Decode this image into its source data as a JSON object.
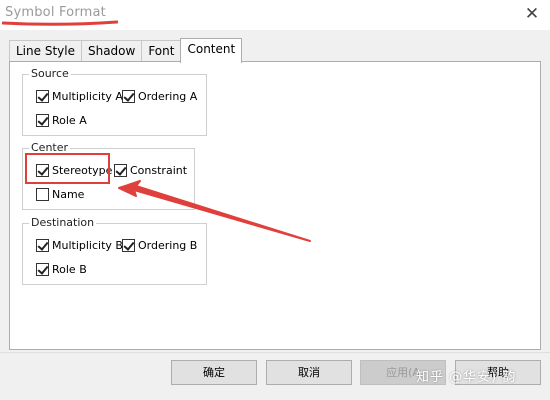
{
  "window": {
    "title": "Symbol Format"
  },
  "tabs": [
    {
      "label": "Line Style",
      "active": false
    },
    {
      "label": "Shadow",
      "active": false
    },
    {
      "label": "Font",
      "active": false
    },
    {
      "label": "Content",
      "active": true
    }
  ],
  "groups": {
    "source": {
      "label": "Source",
      "items": [
        {
          "label": "Multiplicity A",
          "checked": true
        },
        {
          "label": "Ordering A",
          "checked": true
        },
        {
          "label": "Role A",
          "checked": true
        }
      ]
    },
    "center": {
      "label": "Center",
      "items": [
        {
          "label": "Stereotype",
          "checked": true
        },
        {
          "label": "Constraint",
          "checked": true
        },
        {
          "label": "Name",
          "checked": false
        }
      ]
    },
    "destination": {
      "label": "Destination",
      "items": [
        {
          "label": "Multiplicity B",
          "checked": true
        },
        {
          "label": "Ordering B",
          "checked": true
        },
        {
          "label": "Role B",
          "checked": true
        }
      ]
    }
  },
  "buttons": {
    "ok": "确定",
    "cancel": "取消",
    "apply": "应用(A",
    "help": "帮助"
  },
  "watermark": "知乎 @华安) 韵",
  "colors": {
    "annotation": "#e0403c",
    "panel_bg": "#f0f0f0"
  }
}
